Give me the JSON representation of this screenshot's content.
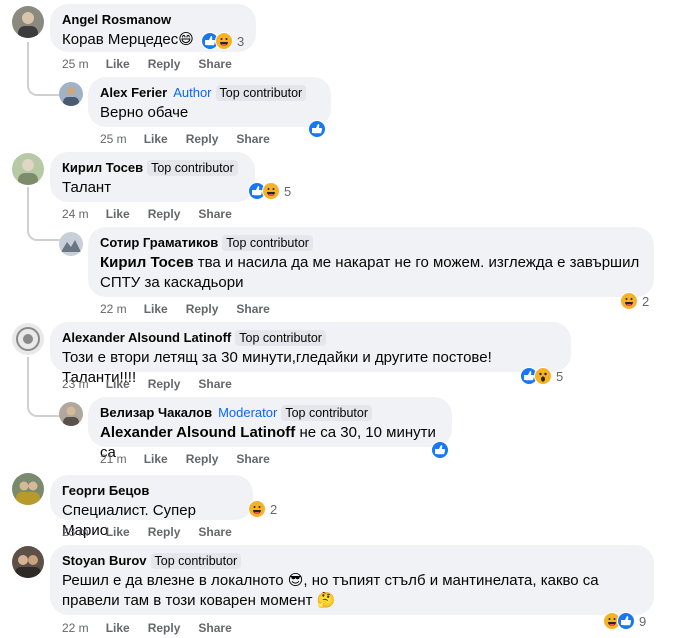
{
  "comments": [
    {
      "name": "Angel Rosmanow",
      "badge": "",
      "role": "",
      "text": "Корав Мерцедес",
      "time": "25 m",
      "like": "Like",
      "reply": "Reply",
      "share": "Share",
      "reactions": [
        "like",
        "haha"
      ],
      "count": "3"
    },
    {
      "name": "Alex Ferier",
      "badge": "Top contributor",
      "role": "Author",
      "text": "Верно обаче",
      "time": "25 m",
      "like": "Like",
      "reply": "Reply",
      "share": "Share",
      "reactions": [
        "like"
      ],
      "count": ""
    },
    {
      "name": "Кирил Тосев",
      "badge": "Top contributor",
      "role": "",
      "text": "Талант",
      "time": "24 m",
      "like": "Like",
      "reply": "Reply",
      "share": "Share",
      "reactions": [
        "like",
        "haha"
      ],
      "count": "5"
    },
    {
      "name": "Сотир Граматиков",
      "badge": "Top contributor",
      "role": "",
      "mention": "Кирил Тосев",
      "text": " тва и насила да ме накарат не го можем. изглежда е завършил",
      "text2": "СПТУ за каскадьори",
      "time": "22 m",
      "like": "Like",
      "reply": "Reply",
      "share": "Share",
      "reactions": [
        "haha"
      ],
      "count": "2"
    },
    {
      "name": "Alexander Alsound Latinoff",
      "badge": "Top contributor",
      "role": "",
      "text": "Този е втори летящ за 30 минути,гледайки и другите постове!Таланти!!!!",
      "time": "23 m",
      "like": "Like",
      "reply": "Reply",
      "share": "Share",
      "reactions": [
        "like",
        "wow"
      ],
      "count": "5"
    },
    {
      "name": "Велизар Чакалов",
      "badge": "Top contributor",
      "role": "Moderator",
      "mention": "Alexander Alsound Latinoff",
      "text": " не са 30, 10 минути са",
      "time": "21 m",
      "like": "Like",
      "reply": "Reply",
      "share": "Share",
      "reactions": [
        "like"
      ],
      "count": ""
    },
    {
      "name": "Георги Бецов",
      "badge": "",
      "role": "",
      "text": "Специалист. Супер Марио",
      "time": "23 m",
      "like": "Like",
      "reply": "Reply",
      "share": "Share",
      "reactions": [
        "haha"
      ],
      "count": "2"
    },
    {
      "name": "Stoyan Burov",
      "badge": "Top contributor",
      "role": "",
      "text": "Решил е да влезне в локалното",
      "text_b": ", но тъпият стълб и мантинелата, какво са",
      "text2": "правели там в този коварен момент",
      "time": "22 m",
      "like": "Like",
      "reply": "Reply",
      "share": "Share",
      "reactions": [
        "haha",
        "like"
      ],
      "count": "9"
    }
  ],
  "colors": {
    "bubble": "#f0f2f5",
    "link": "#0866ff",
    "meta": "#65676b",
    "like": "#1877f2",
    "haha": "#f7b125"
  },
  "icons": [
    "like-icon",
    "haha-icon",
    "wow-icon",
    "sunglasses-emoji-icon",
    "thinking-emoji-icon",
    "grin-emoji-icon"
  ]
}
